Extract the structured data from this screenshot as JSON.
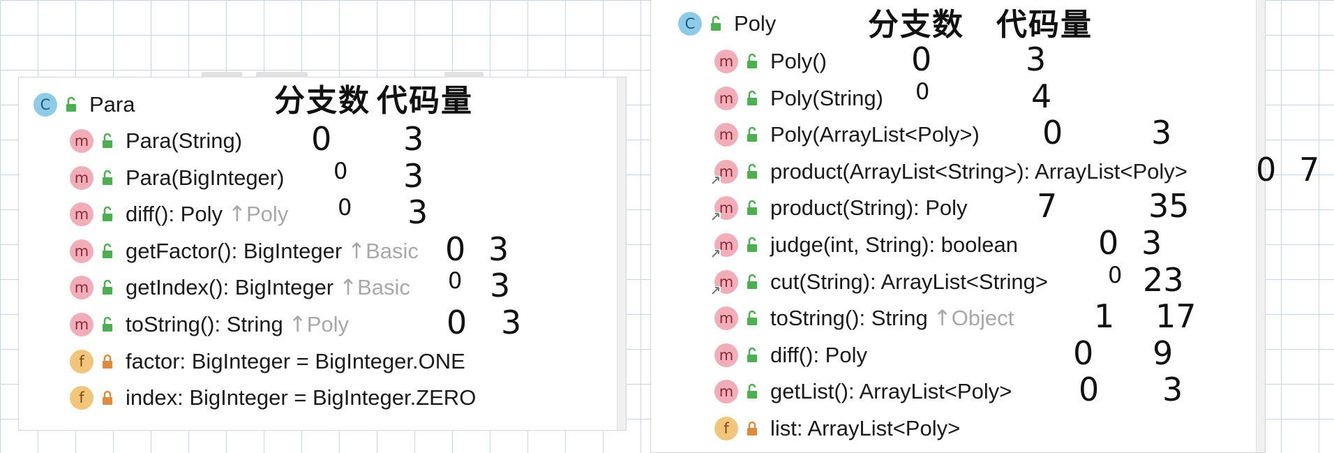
{
  "left_panel": {
    "class_name": "Para",
    "annotations": {
      "heading_methods_count": "分支数",
      "heading_lines": "代码量"
    },
    "members": [
      {
        "kind": "m",
        "text": "Para(String)",
        "hint": "",
        "branches": "0",
        "lines": "3"
      },
      {
        "kind": "m",
        "text": "Para(BigInteger)",
        "hint": "",
        "branches": "0",
        "lines": "3"
      },
      {
        "kind": "m",
        "text": "diff(): Poly",
        "hint": "Poly",
        "branches": "0",
        "lines": "3"
      },
      {
        "kind": "m",
        "text": "getFactor(): BigInteger",
        "hint": "Basic",
        "branches": "0",
        "lines": "3"
      },
      {
        "kind": "m",
        "text": "getIndex(): BigInteger",
        "hint": "Basic",
        "branches": "0",
        "lines": "3"
      },
      {
        "kind": "m",
        "text": "toString(): String",
        "hint": "Poly",
        "branches": "0",
        "lines": "3"
      },
      {
        "kind": "f",
        "text": "factor: BigInteger = BigInteger.ONE",
        "hint": ""
      },
      {
        "kind": "f",
        "text": "index: BigInteger = BigInteger.ZERO",
        "hint": ""
      }
    ]
  },
  "right_panel": {
    "class_name": "Poly",
    "annotations": {
      "heading_methods_count": "分支数",
      "heading_lines": "代码量"
    },
    "members": [
      {
        "kind": "m",
        "text": "Poly()",
        "hint": "",
        "branches": "0",
        "lines": "3"
      },
      {
        "kind": "m",
        "text": "Poly(String)",
        "hint": "",
        "branches": "0",
        "lines": "4"
      },
      {
        "kind": "m",
        "text": "Poly(ArrayList<Poly>)",
        "hint": "",
        "branches": "0",
        "lines": "3"
      },
      {
        "kind": "m",
        "text": "product(ArrayList<String>): ArrayList<Poly>",
        "hint": "",
        "branches": "0",
        "lines": "7"
      },
      {
        "kind": "m",
        "text": "product(String): Poly",
        "hint": "",
        "branches": "7",
        "lines": "35"
      },
      {
        "kind": "m",
        "text": "judge(int, String): boolean",
        "hint": "",
        "branches": "0",
        "lines": "3"
      },
      {
        "kind": "m",
        "text": "cut(String): ArrayList<String>",
        "hint": "",
        "branches": "0",
        "lines": "23"
      },
      {
        "kind": "m",
        "text": "toString(): String",
        "hint": "Object",
        "branches": "1",
        "lines": "17"
      },
      {
        "kind": "m",
        "text": "diff(): Poly",
        "hint": "",
        "branches": "0",
        "lines": "9"
      },
      {
        "kind": "m",
        "text": "getList(): ArrayList<Poly>",
        "hint": "",
        "branches": "0",
        "lines": "3"
      },
      {
        "kind": "f",
        "text": "list: ArrayList<Poly>",
        "hint": ""
      }
    ]
  },
  "icons": {
    "class_badge": "C",
    "method_badge": "m",
    "field_badge": "f",
    "public_icon": "unlock-icon",
    "private_icon": "lock-icon",
    "override_arrow": "↑"
  },
  "colors": {
    "class_badge": "#8ecbe6",
    "method_badge": "#f2aeb8",
    "field_badge": "#f2c67a",
    "public_green": "#4caf50",
    "private_orange": "#e08a3c",
    "hint_gray": "#a8a8a8"
  }
}
